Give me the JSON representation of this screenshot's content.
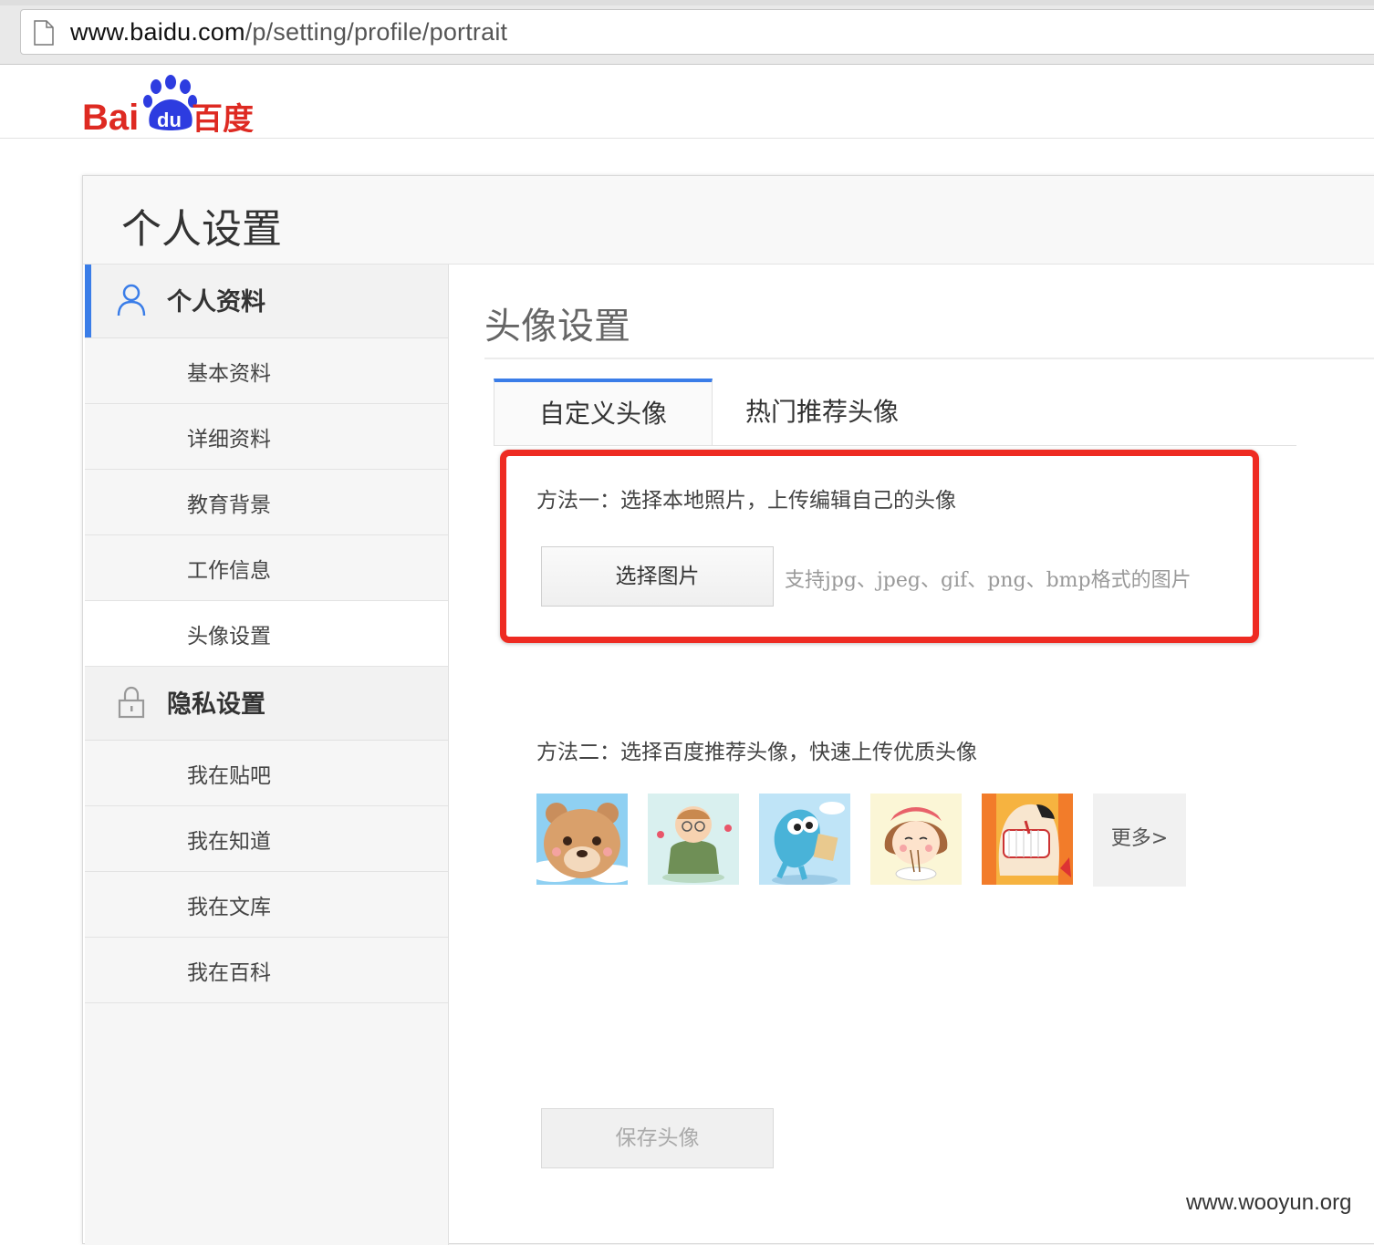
{
  "browser": {
    "url_host": "www.baidu.com",
    "url_path": "/p/setting/profile/portrait"
  },
  "header": {
    "logo_text": "Bai du 百度"
  },
  "panel": {
    "title": "个人设置"
  },
  "sidebar": {
    "groups": [
      {
        "label": "个人资料",
        "icon": "user-icon",
        "items": [
          "基本资料",
          "详细资料",
          "教育背景",
          "工作信息",
          "头像设置"
        ]
      },
      {
        "label": "隐私设置",
        "icon": "lock-icon",
        "items": [
          "我在贴吧",
          "我在知道",
          "我在文库",
          "我在百科"
        ]
      }
    ]
  },
  "content": {
    "title": "头像设置",
    "tabs": [
      "自定义头像",
      "热门推荐头像"
    ],
    "method1": "方法一：选择本地照片，上传编辑自己的头像",
    "choose_button": "选择图片",
    "support_text": "支持jpg、jpeg、gif、png、bmp格式的图片",
    "method2": "方法二：选择百度推荐头像，快速上传优质头像",
    "avatars": [
      "bear-avatar",
      "grandpa-avatar",
      "blue-creature-avatar",
      "girl-eating-avatar",
      "laughing-man-avatar"
    ],
    "more_button": "更多>",
    "save_button": "保存头像"
  },
  "watermark": "www.wooyun.org",
  "colors": {
    "accent": "#3a7de8",
    "highlight": "#ee2b22",
    "baidu_red": "#de2a22",
    "baidu_blue": "#2d3ce0"
  }
}
